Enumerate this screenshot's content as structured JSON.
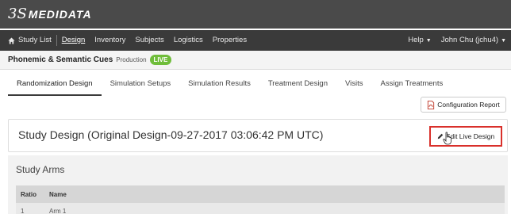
{
  "brand": {
    "logo_mark": "3S",
    "logo_text": "MEDIDATA"
  },
  "nav": {
    "study_list": "Study List",
    "items": [
      "Design",
      "Inventory",
      "Subjects",
      "Logistics",
      "Properties"
    ],
    "help": "Help",
    "user": "John Chu (jchu4)"
  },
  "study": {
    "name": "Phonemic & Semantic Cues",
    "environment": "Production",
    "status": "LIVE"
  },
  "tabs": [
    "Randomization Design",
    "Simulation Setups",
    "Simulation Results",
    "Treatment Design",
    "Visits",
    "Assign Treatments"
  ],
  "config_report_label": "Configuration Report",
  "design": {
    "title": "Study Design (Original Design-09-27-2017 03:06:42 PM UTC)",
    "edit_label": "Edit Live Design"
  },
  "arms": {
    "title": "Study Arms",
    "columns": [
      "Ratio",
      "Name"
    ],
    "rows": [
      {
        "ratio": "1",
        "name": "Arm 1"
      }
    ]
  },
  "colors": {
    "live_badge": "#6fbd3a",
    "highlight": "#d9302b",
    "nav_bg": "#3a3a3a",
    "brand_bg": "#4a4a4a"
  }
}
